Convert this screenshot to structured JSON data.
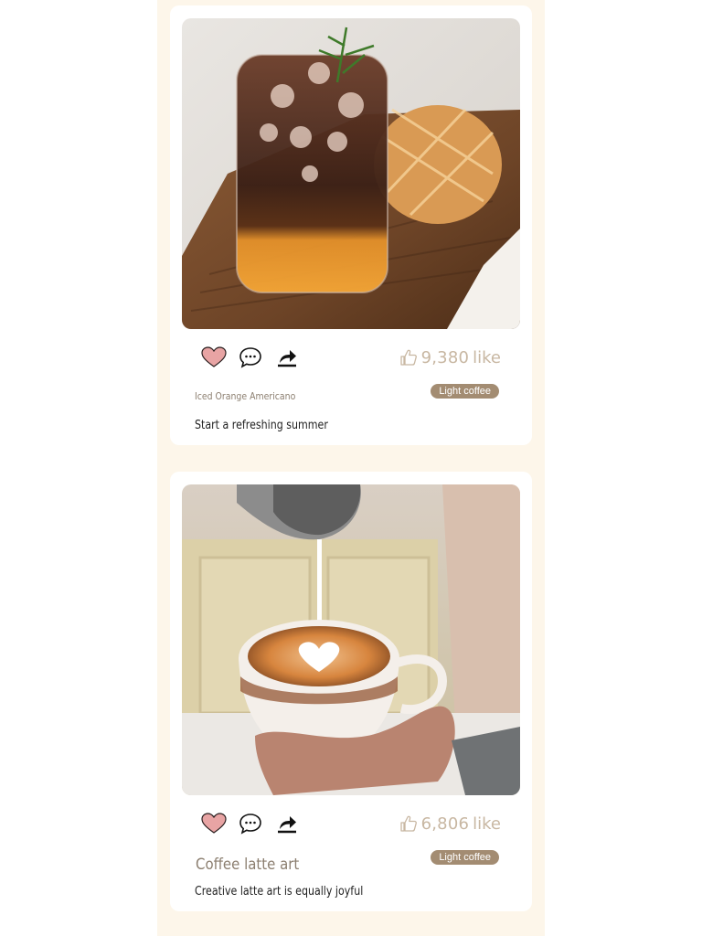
{
  "posts": [
    {
      "image_alt": "Iced coffee with orange layer and a bun on a wooden board",
      "likes_count": "9,380",
      "likes_unit": "like",
      "category": "Light coffee",
      "title": "Iced Orange Americano",
      "subtitle": "Start a refreshing summer"
    },
    {
      "image_alt": "Hand holding a latte cup while milk is poured forming a heart",
      "likes_count": "6,806",
      "likes_unit": "like",
      "category": "Light coffee",
      "title": "Coffee latte art",
      "subtitle": "Creative latte art is equally joyful"
    }
  ],
  "icons": {
    "like": "heart-icon",
    "comment": "comment-icon",
    "share": "share-icon",
    "likes": "thumbs-up-icon"
  },
  "colors": {
    "feed_background": "#fdf6ea",
    "heart": "#e8a4a4",
    "badge": "#a38c72",
    "likes_text": "#c8b7a2"
  }
}
